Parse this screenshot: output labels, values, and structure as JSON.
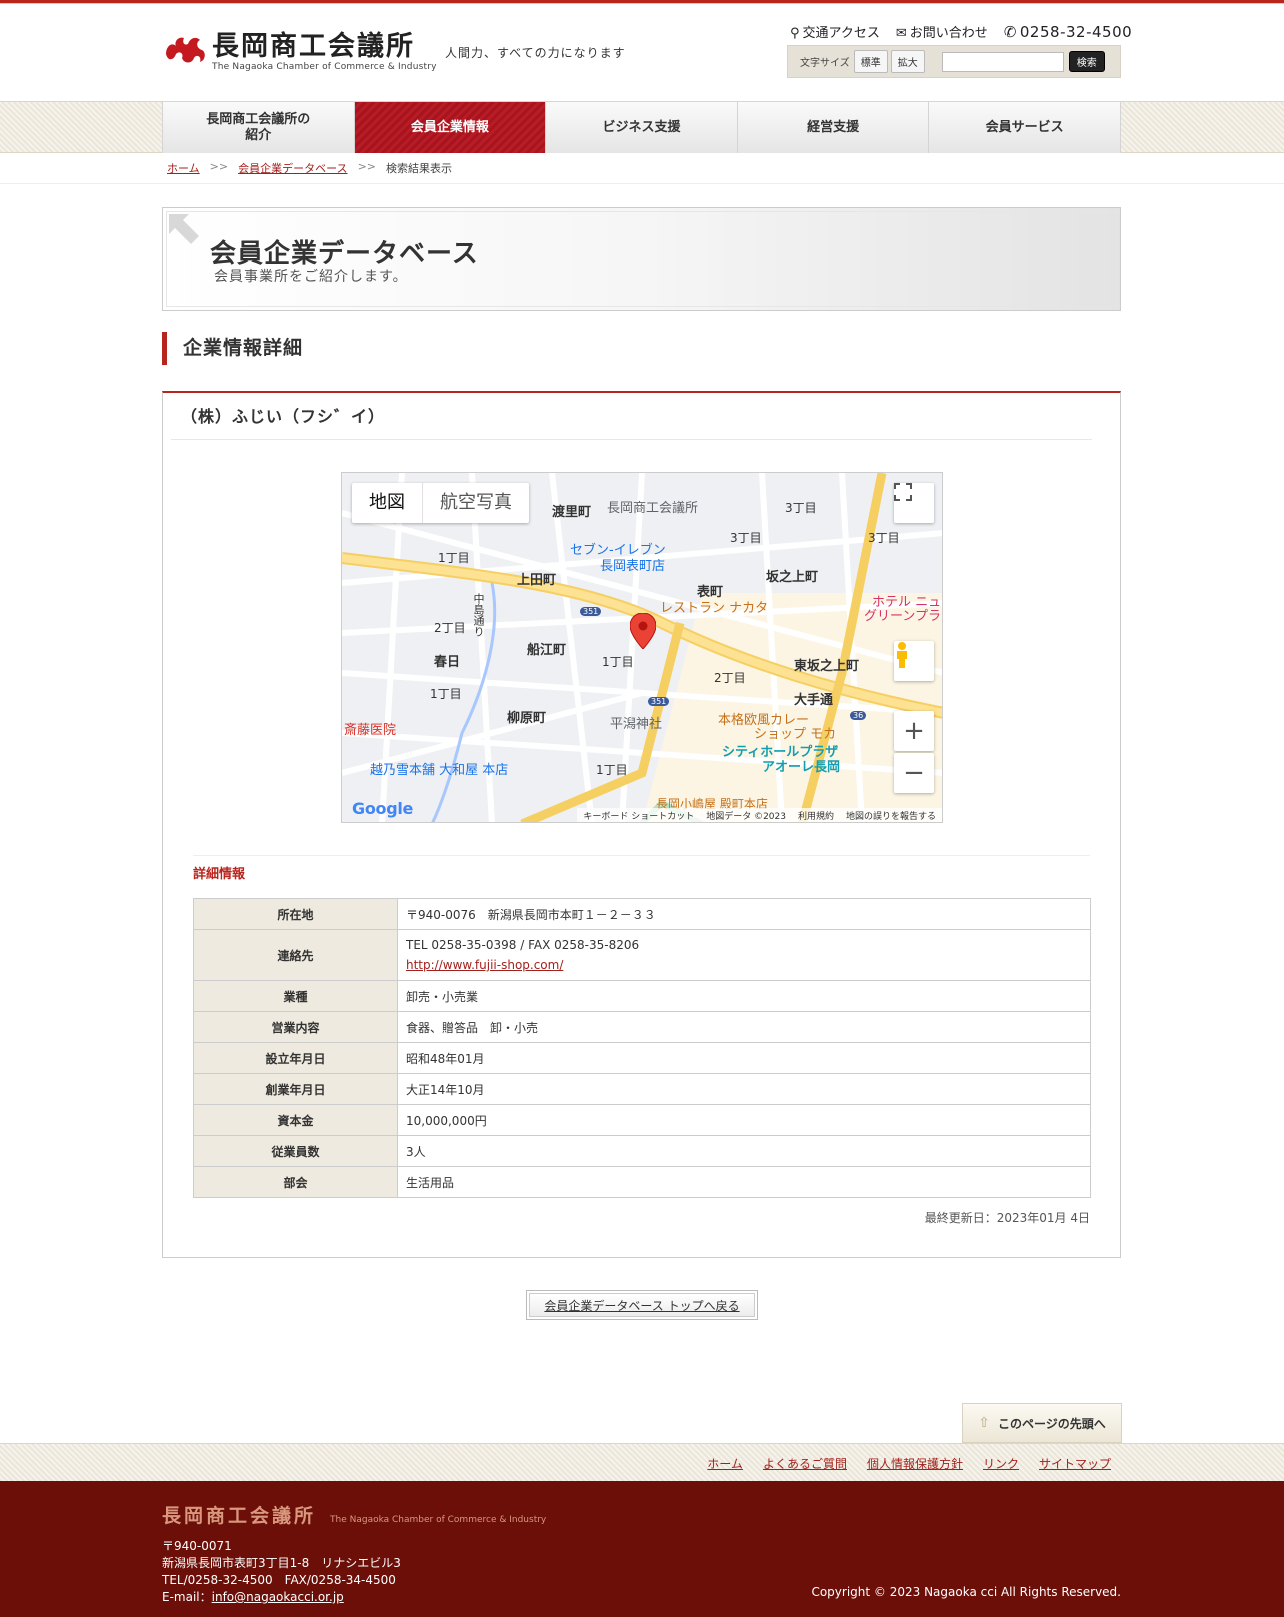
{
  "header": {
    "logo_jp": "長岡商工会議所",
    "logo_en": "The Nagaoka Chamber of Commerce & Industry",
    "tagline": "人間力、すべての力になります",
    "links": {
      "access": "交通アクセス",
      "contact": "お問い合わせ",
      "tel": "0258-32-4500"
    },
    "font_size_label": "文字サイズ",
    "font_normal": "標準",
    "font_large": "拡大",
    "search_button": "検索",
    "search_value": ""
  },
  "nav": {
    "items": [
      {
        "label": "長岡商工会議所の\n紹介"
      },
      {
        "label": "会員企業情報"
      },
      {
        "label": "ビジネス支援"
      },
      {
        "label": "経営支援"
      },
      {
        "label": "会員サービス"
      }
    ],
    "active_index": 1
  },
  "breadcrumb": {
    "home": "ホーム",
    "db": "会員企業データベース",
    "current": "検索結果表示"
  },
  "banner": {
    "title": "会員企業データベース",
    "subtitle": "会員事業所をご紹介します。"
  },
  "section_heading": "企業情報詳細",
  "company": {
    "name": "（株）ふじい（フシ゛イ）"
  },
  "map": {
    "tab_map": "地図",
    "tab_satellite": "航空写真",
    "labels": {
      "chamber": "長岡商工会議所",
      "seven": "セブン-イレブン",
      "seven2": "長岡表町店",
      "watari": "渡里町",
      "kamita": "上田町",
      "omote": "表町",
      "sakanoue": "坂之上町",
      "restaurant": "レストラン ナカタ",
      "hotel": "ホテル ニュ",
      "hotel2": "グリーンプラ",
      "funae": "船江町",
      "kasuga": "春日",
      "higashi": "東坂之上町",
      "otedori": "大手通",
      "yanagihara": "柳原町",
      "hirakata": "平潟神社",
      "curry": "本格欧風カレー",
      "curry2": "ショップ モカ",
      "cityhall": "シティホールプラザ",
      "cityhall2": "アオーレ長岡",
      "saito": "斎藤医院",
      "koshino": "越乃雪本舗 大和屋 本店",
      "kojimaya": "長岡小嶋屋 殿町本店",
      "chuo": "中島通り",
      "ch1": "1丁目",
      "ch2": "2丁目",
      "ch3": "3丁目",
      "route": "351",
      "route36": "36"
    },
    "footer_items": [
      "キーボード ショートカット",
      "地図データ ©2023",
      "利用規約",
      "地図の誤りを報告する"
    ],
    "google": "Google"
  },
  "detail": {
    "label": "詳細情報",
    "rows": [
      {
        "k": "所在地",
        "v": "〒940-0076　新潟県長岡市本町１－２－３３"
      },
      {
        "k": "連絡先",
        "v": "TEL 0258-35-0398 / FAX 0258-35-8206",
        "link": "http://www.fujii-shop.com/"
      },
      {
        "k": "業種",
        "v": "卸売・小売業"
      },
      {
        "k": "営業内容",
        "v": "食器、贈答品　卸・小売"
      },
      {
        "k": "設立年月日",
        "v": "昭和48年01月"
      },
      {
        "k": "創業年月日",
        "v": "大正14年10月"
      },
      {
        "k": "資本金",
        "v": "10,000,000円"
      },
      {
        "k": "従業員数",
        "v": "3人"
      },
      {
        "k": "部会",
        "v": "生活用品"
      }
    ],
    "updated": "最終更新日：2023年01月 4日"
  },
  "back_button": "会員企業データベース トップへ戻る",
  "page_top": "このページの先頭へ",
  "footer_nav": [
    "ホーム",
    "よくあるご質問",
    "個人情報保護方針",
    "リンク",
    "サイトマップ"
  ],
  "footer": {
    "logo_jp": "長岡商工会議所",
    "logo_en": "The Nagaoka Chamber of Commerce & Industry",
    "zip": "〒940-0071",
    "address": "新潟県長岡市表町3丁目1-8　リナシエビル3",
    "telfax": "TEL/0258-32-4500　FAX/0258-34-4500",
    "email_label": "E-mail：",
    "email": "info@nagaokacci.or.jp",
    "copyright": "Copyright © 2023 Nagaoka cci All Rights Reserved."
  }
}
